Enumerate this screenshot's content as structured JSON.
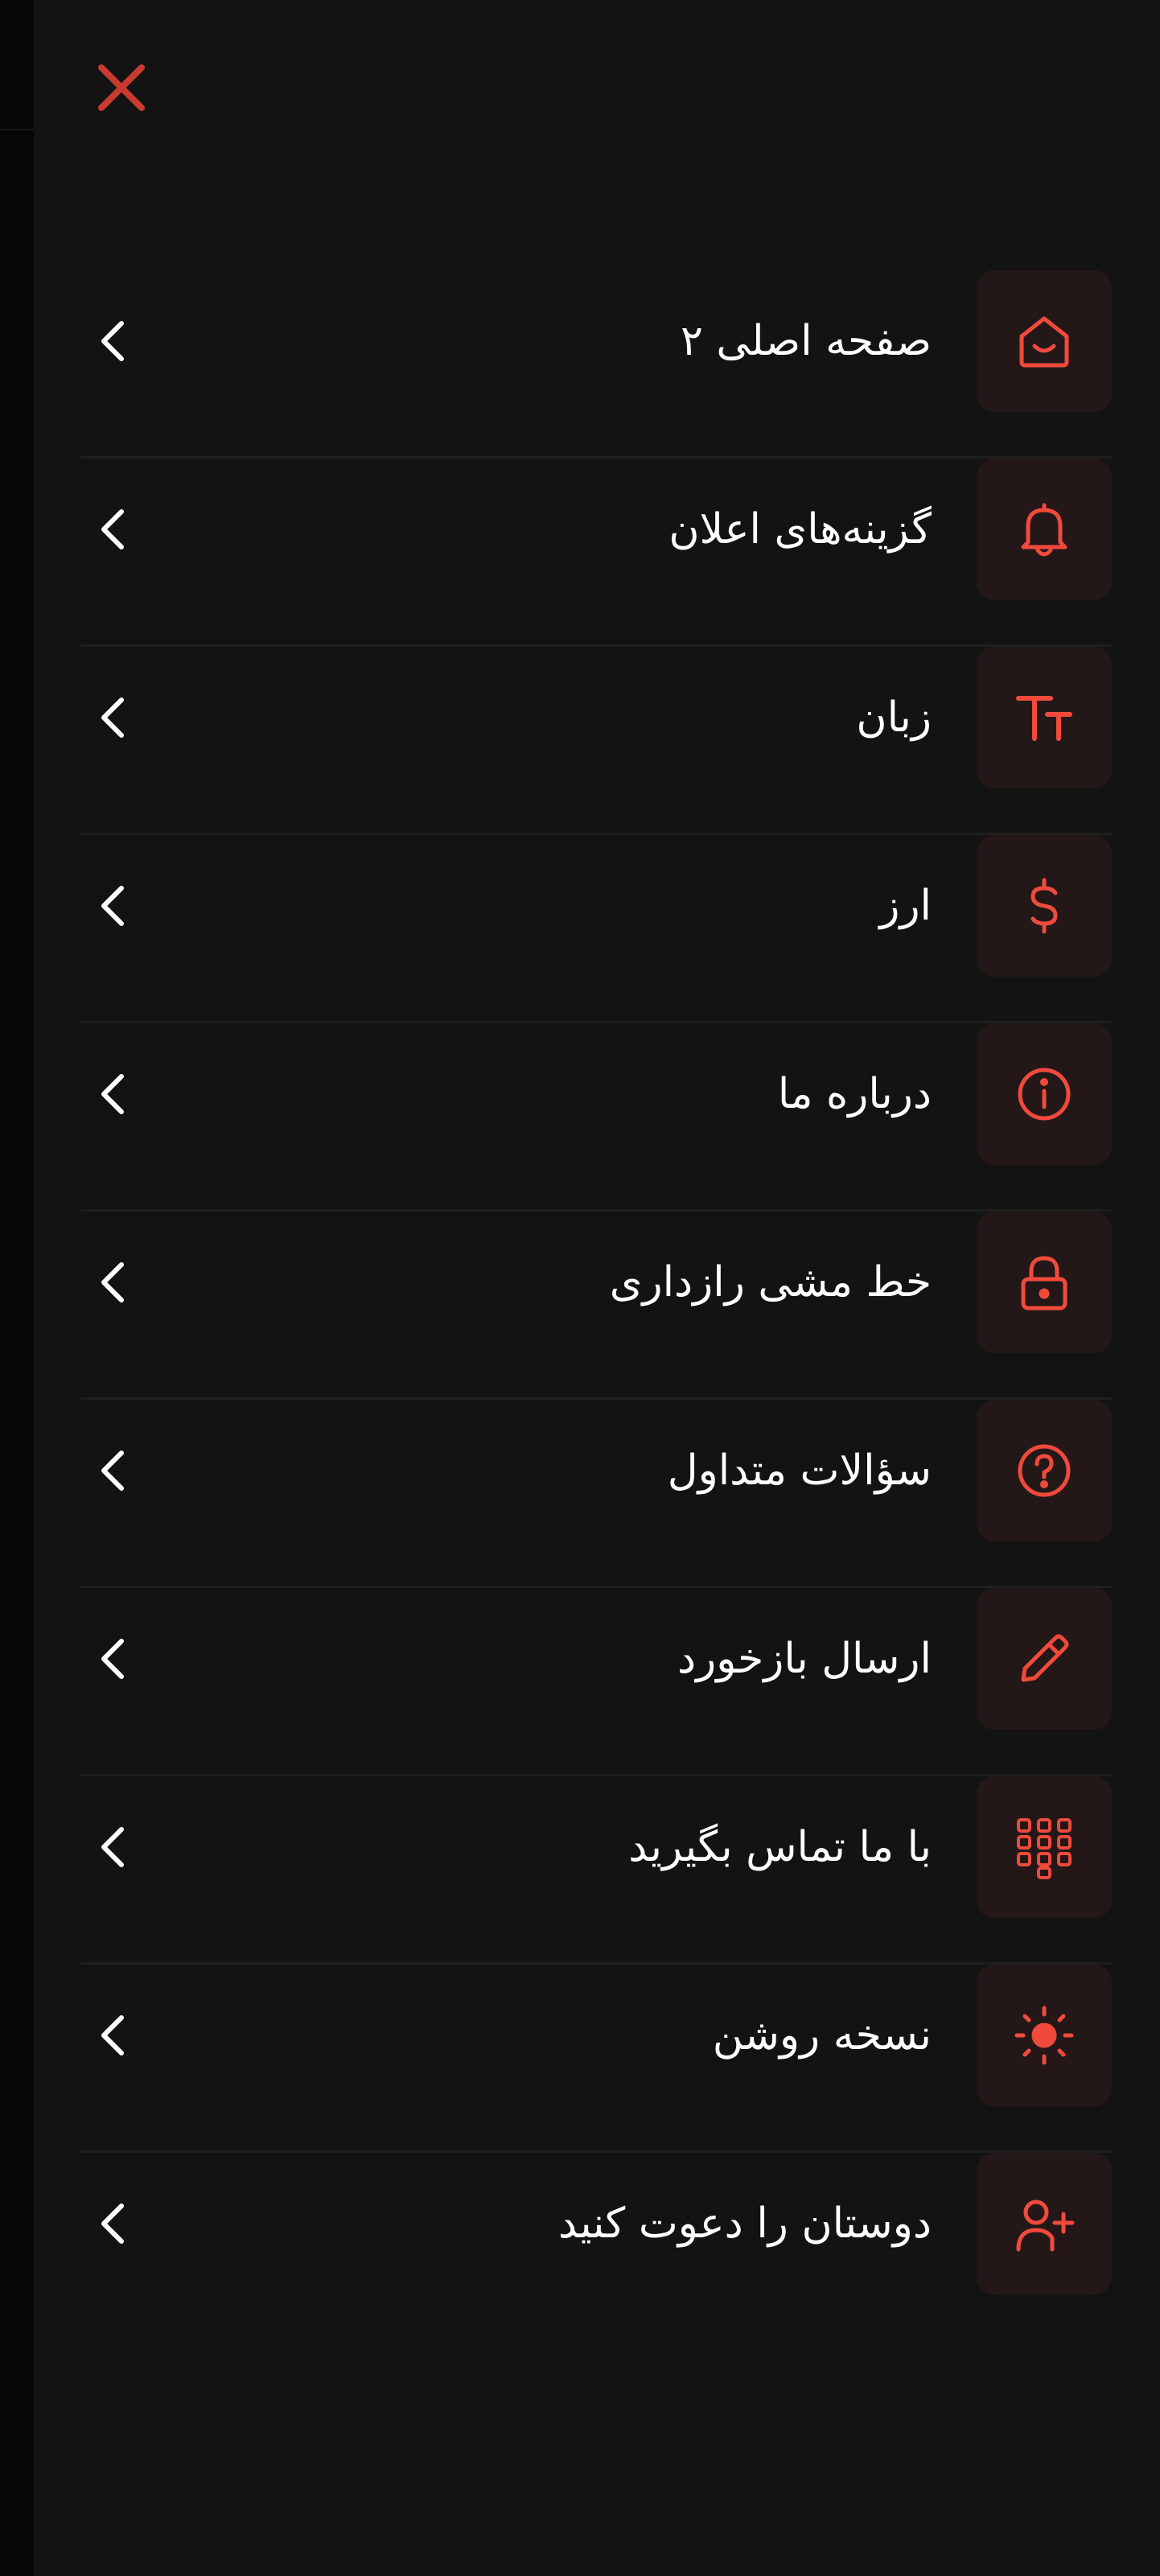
{
  "theme": {
    "accent": "#f04a3c",
    "close_color": "#c93a2f",
    "background": "#131313",
    "icon_bg": "#231817",
    "text": "#ffffff"
  },
  "close_button": {
    "icon": "close-icon"
  },
  "menu": {
    "items": [
      {
        "label": "صفحه اصلی ۲",
        "icon": "home-icon"
      },
      {
        "label": "گزینه‌های اعلان",
        "icon": "bell-icon"
      },
      {
        "label": "زبان",
        "icon": "text-size-icon"
      },
      {
        "label": "ارز",
        "icon": "dollar-icon"
      },
      {
        "label": "درباره ما",
        "icon": "info-icon"
      },
      {
        "label": "خط مشی رازداری",
        "icon": "lock-icon"
      },
      {
        "label": "سؤالات متداول",
        "icon": "question-icon"
      },
      {
        "label": "ارسال بازخورد",
        "icon": "pencil-icon"
      },
      {
        "label": "با ما تماس بگیرید",
        "icon": "dialpad-icon"
      },
      {
        "label": "نسخه روشن",
        "icon": "sun-icon"
      },
      {
        "label": "دوستان را دعوت کنید",
        "icon": "user-plus-icon"
      }
    ]
  }
}
